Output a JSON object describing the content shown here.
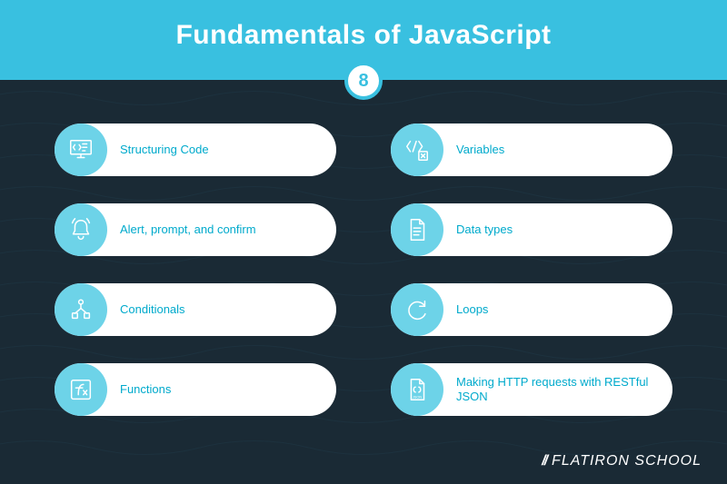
{
  "title": "Fundamentals of JavaScript",
  "count": "8",
  "items": [
    {
      "icon": "monitor-code-icon",
      "label": "Structuring Code"
    },
    {
      "icon": "code-var-icon",
      "label": "Variables"
    },
    {
      "icon": "bell-icon",
      "label": "Alert, prompt, and confirm"
    },
    {
      "icon": "document-icon",
      "label": "Data types"
    },
    {
      "icon": "branch-icon",
      "label": "Conditionals"
    },
    {
      "icon": "loop-icon",
      "label": "Loops"
    },
    {
      "icon": "function-icon",
      "label": "Functions"
    },
    {
      "icon": "json-icon",
      "label": "Making HTTP requests with RESTful JSON"
    }
  ],
  "footer": {
    "slashes": "//",
    "brand": "FLATIRON SCHOOL"
  },
  "colors": {
    "header": "#39c0e0",
    "background": "#1a2a35",
    "accent": "#00aacc",
    "iconCircle": "#6dd3e8"
  }
}
